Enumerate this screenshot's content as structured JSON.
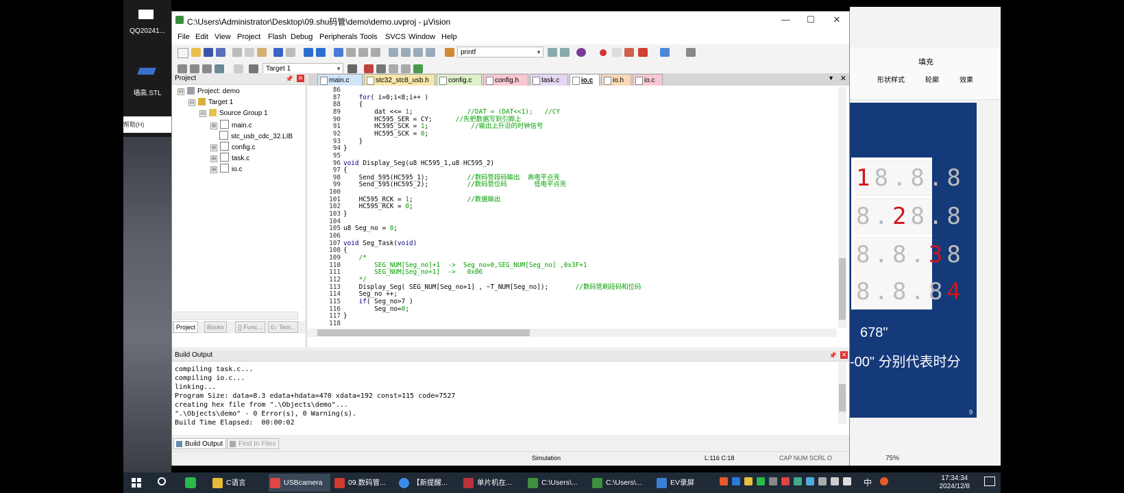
{
  "desktop": {
    "icons": [
      {
        "label": "QQ20241..."
      },
      {
        "label": "墙高.STL"
      }
    ],
    "help_label": "帮助(H)"
  },
  "window": {
    "title": "C:\\Users\\Administrator\\Desktop\\09.shu码管\\demo\\demo.uvproj - µVision",
    "controls": {
      "minimize": "—",
      "maximize": "☐",
      "close": "✕"
    }
  },
  "menu": [
    "File",
    "Edit",
    "View",
    "Project",
    "Flash",
    "Debug",
    "Peripherals",
    "Tools",
    "SVCS",
    "Window",
    "Help"
  ],
  "toolbar": {
    "find_combo_value": "printf",
    "target_combo_value": "Target 1"
  },
  "project_panel": {
    "title": "Project",
    "tree": [
      {
        "label": "Project: demo",
        "level": 0,
        "expander": "⊟"
      },
      {
        "label": "Target 1",
        "level": 1,
        "expander": "⊟"
      },
      {
        "label": "Source Group 1",
        "level": 2,
        "expander": "⊟"
      },
      {
        "label": "main.c",
        "level": 3,
        "expander": "⊞"
      },
      {
        "label": "stc_usb_cdc_32.LIB",
        "level": 3,
        "expander": ""
      },
      {
        "label": "config.c",
        "level": 3,
        "expander": "⊞"
      },
      {
        "label": "task.c",
        "level": 3,
        "expander": "⊞"
      },
      {
        "label": "io.c",
        "level": 3,
        "expander": "⊞"
      }
    ],
    "bottom_tabs": [
      "Project",
      "Books",
      "{} Func...",
      "0↓ Tem..."
    ]
  },
  "editor": {
    "tabs": [
      {
        "label": "main.c",
        "color": "#cfe4f7",
        "active": false
      },
      {
        "label": "stc32_stc8_usb.h",
        "color": "#f6e6a8",
        "active": false
      },
      {
        "label": "config.c",
        "color": "#dff0c9",
        "active": false
      },
      {
        "label": "config.h",
        "color": "#f9c9d2",
        "active": false
      },
      {
        "label": "task.c",
        "color": "#e5d6f2",
        "active": false
      },
      {
        "label": "io.c",
        "color": "#ffffff",
        "active": true
      },
      {
        "label": "io.h",
        "color": "#f9d9b6",
        "active": false
      },
      {
        "label": "io.c",
        "color": "#f9c9d2",
        "active": false
      }
    ],
    "lines": [
      {
        "n": "86",
        "parts": []
      },
      {
        "n": "87",
        "parts": [
          {
            "t": "    "
          },
          {
            "t": "for",
            "c": "kw"
          },
          {
            "t": "( i=0;i<8;i++ )"
          }
        ]
      },
      {
        "n": "88",
        "parts": [
          {
            "t": "    {"
          }
        ]
      },
      {
        "n": "89",
        "parts": [
          {
            "t": "        dat <<= "
          },
          {
            "t": "1",
            "c": "nm"
          },
          {
            "t": ";              "
          },
          {
            "t": "//DAT = (DAT<<1);   //CY",
            "c": "cm"
          }
        ]
      },
      {
        "n": "90",
        "parts": [
          {
            "t": "        HC595_SER = CY;      "
          },
          {
            "t": "//先把数据写到引脚上",
            "c": "cm"
          }
        ]
      },
      {
        "n": "91",
        "parts": [
          {
            "t": "        HC595_SCK = "
          },
          {
            "t": "1",
            "c": "nm"
          },
          {
            "t": ";           "
          },
          {
            "t": "//输出上升沿的时钟信号",
            "c": "cm"
          }
        ]
      },
      {
        "n": "92",
        "parts": [
          {
            "t": "        HC595_SCK = "
          },
          {
            "t": "0",
            "c": "nm"
          },
          {
            "t": ";"
          }
        ]
      },
      {
        "n": "93",
        "parts": [
          {
            "t": "    }"
          }
        ]
      },
      {
        "n": "94",
        "parts": [
          {
            "t": "}"
          }
        ]
      },
      {
        "n": "95",
        "parts": []
      },
      {
        "n": "96",
        "parts": [
          {
            "t": "void",
            "c": "kw"
          },
          {
            "t": " Display_Seg(u8 HC595_1,u8 HC595_2)"
          }
        ]
      },
      {
        "n": "97",
        "parts": [
          {
            "t": "{"
          }
        ]
      },
      {
        "n": "98",
        "parts": [
          {
            "t": "    Send_595(HC595_1);          "
          },
          {
            "t": "//数码管段码输出  高电平点亮",
            "c": "cm"
          }
        ]
      },
      {
        "n": "99",
        "parts": [
          {
            "t": "    Send_595(HC595_2);          "
          },
          {
            "t": "//数码管位码       低电平点亮",
            "c": "cm"
          }
        ]
      },
      {
        "n": "100",
        "parts": []
      },
      {
        "n": "101",
        "parts": [
          {
            "t": "    HC595_RCK = "
          },
          {
            "t": "1",
            "c": "nm"
          },
          {
            "t": ";              "
          },
          {
            "t": "//数据输出",
            "c": "cm"
          }
        ]
      },
      {
        "n": "102",
        "parts": [
          {
            "t": "    HC595_RCK = "
          },
          {
            "t": "0",
            "c": "nm"
          },
          {
            "t": ";"
          }
        ]
      },
      {
        "n": "103",
        "parts": [
          {
            "t": "}"
          }
        ]
      },
      {
        "n": "104",
        "parts": []
      },
      {
        "n": "105",
        "parts": [
          {
            "t": "u8 Seg_no = "
          },
          {
            "t": "0",
            "c": "nm"
          },
          {
            "t": ";"
          }
        ]
      },
      {
        "n": "106",
        "parts": []
      },
      {
        "n": "107",
        "parts": [
          {
            "t": "void",
            "c": "kw"
          },
          {
            "t": " Seg_Task("
          },
          {
            "t": "void",
            "c": "kw"
          },
          {
            "t": ")"
          }
        ]
      },
      {
        "n": "108",
        "parts": [
          {
            "t": "{"
          }
        ]
      },
      {
        "n": "109",
        "parts": [
          {
            "t": "    "
          },
          {
            "t": "/*",
            "c": "cm"
          }
        ]
      },
      {
        "n": "110",
        "parts": [
          {
            "t": "        SEG_NUM[Seg_no]+1  ->  Seg_no=0,SEG_NUM[Seg_no] ,0x3F+1",
            "c": "cm"
          }
        ]
      },
      {
        "n": "111",
        "parts": [
          {
            "t": "        SEG_NUM[Seg_no+1]  ->   0x06",
            "c": "cm"
          }
        ]
      },
      {
        "n": "112",
        "parts": [
          {
            "t": "    "
          },
          {
            "t": "*/",
            "c": "cm"
          }
        ]
      },
      {
        "n": "113",
        "parts": [
          {
            "t": "    Display_Seg( SEG_NUM[Seg_no+1] , ~T_NUM[Seg_no]);       "
          },
          {
            "t": "//数码管刷段码和位码",
            "c": "cm"
          }
        ]
      },
      {
        "n": "114",
        "parts": [
          {
            "t": "    Seg_no ++;"
          }
        ]
      },
      {
        "n": "115",
        "parts": [
          {
            "t": "    "
          },
          {
            "t": "if",
            "c": "kw"
          },
          {
            "t": "( Seg_no>7 )"
          }
        ]
      },
      {
        "n": "116",
        "parts": [
          {
            "t": "        Seg_no="
          },
          {
            "t": "0",
            "c": "nm"
          },
          {
            "t": ";"
          }
        ]
      },
      {
        "n": "117",
        "parts": [
          {
            "t": "}"
          }
        ]
      },
      {
        "n": "118",
        "parts": []
      }
    ]
  },
  "build_output": {
    "title": "Build Output",
    "lines": [
      "compiling task.c...",
      "compiling io.c...",
      "linking...",
      "Program Size: data=8.3 edata+hdata=470 xdata=192 const=115 code=7527",
      "creating hex file from \".\\Objects\\demo\"...",
      "\".\\Objects\\demo\" - 0 Error(s), 0 Warning(s).",
      "Build Time Elapsed:  00:00:02"
    ],
    "tabs": [
      "Build Output",
      "Find In Files"
    ]
  },
  "status": {
    "mode": "Simulation",
    "position": "L:116 C:18",
    "indicators": "CAP  NUM  SCRL  O"
  },
  "right_app": {
    "ribbon": [
      "填充",
      "形状样式",
      "轮廓",
      "效果"
    ],
    "segment_rows": [
      {
        "lit": "1",
        "unlit": "8.8.8"
      },
      {
        "lit": "2",
        "unlit": "8.8"
      },
      {
        "lit": "3",
        "unlit": "8"
      },
      {
        "lit": "4",
        "unlit": "8.8.8"
      }
    ],
    "subtitle_1": "678\"",
    "subtitle_2": "-00\"  分别代表时分",
    "zoom": "75%",
    "page_no": "9"
  },
  "taskbar": {
    "items": [
      {
        "label": "C语言",
        "color": "#e8b83a"
      },
      {
        "label": "USBcamera",
        "color": "#e04646"
      },
      {
        "label": "09.数码管...",
        "color": "#d23a2e"
      },
      {
        "label": "【新提醒...",
        "color": "#3a8ee6"
      },
      {
        "label": "单片机在...",
        "color": "#b8323a"
      },
      {
        "label": "C:\\Users\\...",
        "color": "#3f8f3f"
      },
      {
        "label": "C:\\Users\\...",
        "color": "#3f8f3f"
      },
      {
        "label": "EV录屏",
        "color": "#3a7fd6"
      }
    ],
    "time": "17:34:34",
    "date": "2024/12/8",
    "ime": "中"
  }
}
